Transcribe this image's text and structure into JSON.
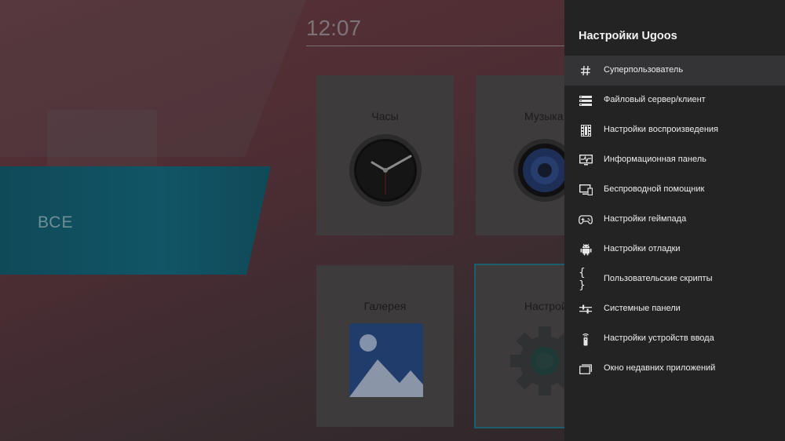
{
  "launcher": {
    "clock": "12:07",
    "category": "ВСЕ",
    "tiles": [
      {
        "title": "Часы"
      },
      {
        "title": "Музыка"
      },
      {
        "title": "Галерея"
      },
      {
        "title": "Настройки"
      }
    ]
  },
  "panel": {
    "title": "Настройки Ugoos",
    "items": [
      {
        "label": "Суперпользователь",
        "icon": "hash-icon"
      },
      {
        "label": "Файловый сервер/клиент",
        "icon": "server-icon"
      },
      {
        "label": "Настройки воспроизведения",
        "icon": "film-icon"
      },
      {
        "label": "Информационная панель",
        "icon": "monitor-pulse-icon"
      },
      {
        "label": "Беспроводной помощник",
        "icon": "cast-devices-icon"
      },
      {
        "label": "Настройки геймпада",
        "icon": "gamepad-icon"
      },
      {
        "label": "Настройки отладки",
        "icon": "android-icon"
      },
      {
        "label": "Пользовательские скрипты",
        "icon": "braces-icon"
      },
      {
        "label": "Системные панели",
        "icon": "sliders-icon"
      },
      {
        "label": "Настройки устройств ввода",
        "icon": "remote-control-icon"
      },
      {
        "label": "Окно недавних приложений",
        "icon": "recent-windows-icon"
      }
    ],
    "selected_index": 0
  },
  "colors": {
    "panel_bg": "#232323",
    "selected_bg": "#343436",
    "accent_teal": "#115566"
  }
}
